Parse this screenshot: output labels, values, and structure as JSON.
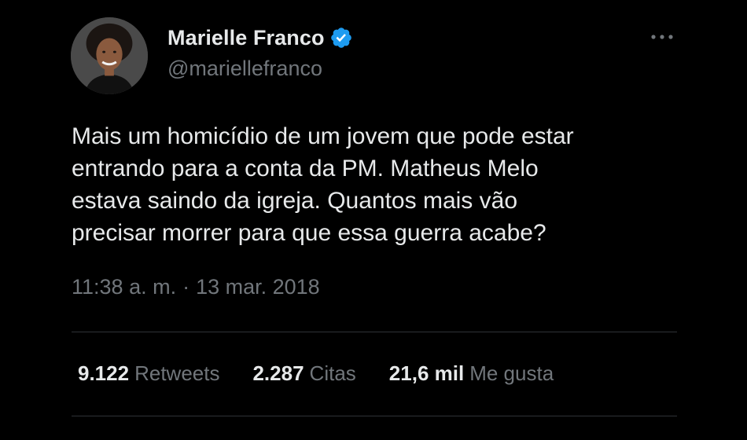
{
  "author": {
    "display_name": "Marielle Franco",
    "handle": "@mariellefranco",
    "verified": true
  },
  "tweet": {
    "text": "Mais um homicídio de um jovem que pode estar\nentrando para a conta da PM. Matheus Melo\nestava saindo da igreja. Quantos mais vão\nprecisar morrer para que essa guerra acabe?",
    "time": "11:38 a. m.",
    "separator": "·",
    "date": "13 mar. 2018"
  },
  "stats": {
    "retweets_value": "9.122",
    "retweets_label": "Retweets",
    "quotes_value": "2.287",
    "quotes_label": "Citas",
    "likes_value": "21,6 mil",
    "likes_label": "Me gusta"
  },
  "icons": {
    "verified": "verified-badge-icon",
    "more": "more-options-icon"
  },
  "colors": {
    "background": "#000000",
    "text_primary": "#e7e9ea",
    "text_secondary": "#71767b",
    "verified_blue": "#1d9bf0",
    "divider": "#2f3336"
  }
}
